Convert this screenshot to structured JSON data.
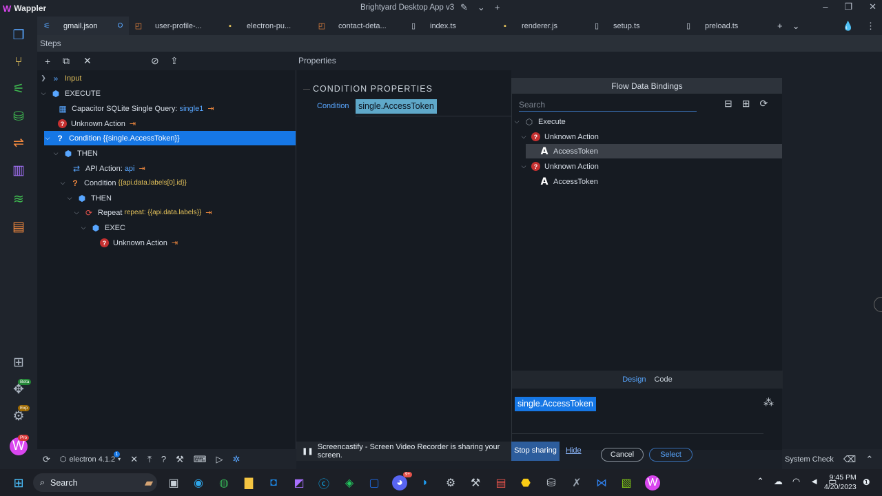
{
  "app": {
    "name": "Wappler",
    "window_title": "Brightyard Desktop App v3"
  },
  "tabs": [
    {
      "label": "gmail.json",
      "icon": "flow-icon",
      "active": true,
      "unsaved": true
    },
    {
      "label": "user-profile-...",
      "icon": "html-icon"
    },
    {
      "label": "electron-pu...",
      "icon": "js-icon"
    },
    {
      "label": "contact-deta...",
      "icon": "html-icon"
    },
    {
      "label": "index.ts",
      "icon": "file-icon"
    },
    {
      "label": "renderer.js",
      "icon": "js-icon"
    },
    {
      "label": "setup.ts",
      "icon": "file-icon"
    },
    {
      "label": "preload.ts",
      "icon": "file-icon"
    }
  ],
  "sidebar": {
    "badges": {
      "beta": "Beta",
      "exp": "Exp",
      "pro": "Pro"
    }
  },
  "steps": {
    "header": "Steps",
    "tree": [
      {
        "label": "Input",
        "icon": "input-icon"
      },
      {
        "label": "EXECUTE",
        "icon": "cube-icon"
      },
      {
        "label": "Capacitor SQLite Single Query:",
        "value": "single1",
        "icon": "table-icon"
      },
      {
        "label": "Unknown Action",
        "icon": "error-icon"
      },
      {
        "label": "Condition",
        "value": "{{single.AccessToken}}",
        "icon": "question-icon",
        "selected": true
      },
      {
        "label": "THEN",
        "icon": "cube-icon"
      },
      {
        "label": "API Action:",
        "value": "api",
        "icon": "api-icon"
      },
      {
        "label": "Condition",
        "value": "{{api.data.labels[0].id}}",
        "icon": "question-icon"
      },
      {
        "label": "THEN",
        "icon": "cube-icon"
      },
      {
        "label": "Repeat",
        "value": "repeat: {{api.data.labels}}",
        "icon": "repeat-icon"
      },
      {
        "label": "EXEC",
        "icon": "cube-icon"
      },
      {
        "label": "Unknown Action",
        "icon": "error-icon"
      }
    ]
  },
  "properties": {
    "header": "Properties",
    "section_title": "CONDITION PROPERTIES",
    "condition_label": "Condition",
    "condition_value": "single.AccessToken"
  },
  "flow_bindings": {
    "title": "Flow Data Bindings",
    "search_placeholder": "Search",
    "tree": [
      {
        "label": "Execute"
      },
      {
        "label": "Unknown Action"
      },
      {
        "label": "AccessToken",
        "highlighted": true
      },
      {
        "label": "Unknown Action"
      },
      {
        "label": "AccessToken"
      }
    ],
    "tab_design": "Design",
    "tab_code": "Code",
    "selected_binding": "single.AccessToken"
  },
  "share_bar": {
    "message": "Screencastify - Screen Video Recorder is sharing your screen.",
    "stop_label": "Stop sharing",
    "hide_label": "Hide"
  },
  "dialog": {
    "cancel_label": "Cancel",
    "select_label": "Select"
  },
  "statusbar": {
    "target": "electron 4.1.2",
    "target_badge": "1",
    "system_check": "System Check"
  },
  "taskbar": {
    "search_label": "Search",
    "time": "9:45 PM",
    "date": "4/20/2023",
    "discord_badge": "9+"
  },
  "colors": {
    "accent": "#1677e5",
    "link": "#58a6ff",
    "error": "#c53030",
    "warning": "#f0883e"
  }
}
